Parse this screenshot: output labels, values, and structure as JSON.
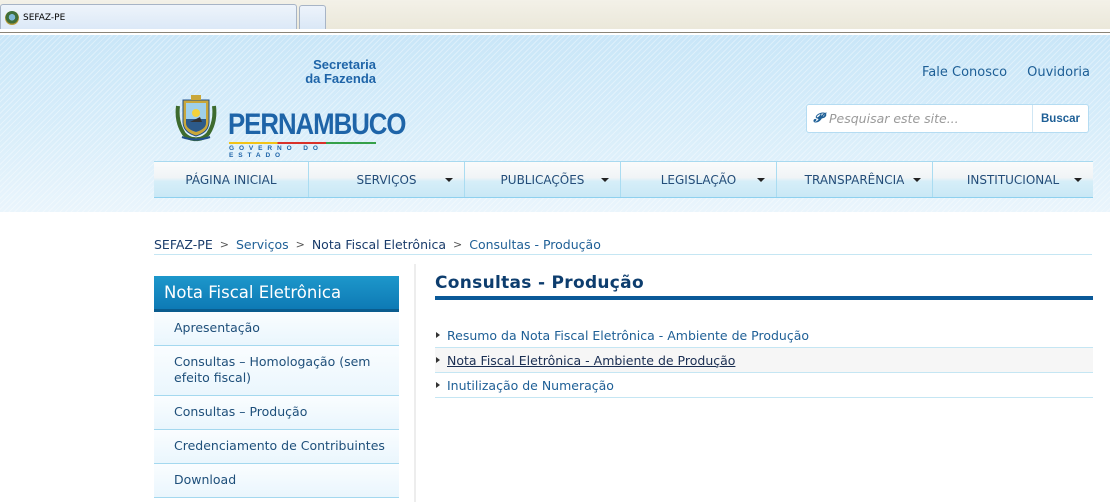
{
  "browser": {
    "tab_title": "SEFAZ-PE"
  },
  "header": {
    "logo": {
      "secretaria_line1": "Secretaria",
      "secretaria_line2": "da Fazenda",
      "state_name": "PERNAMBUCO",
      "subtitle": "GOVERNO DO ESTADO"
    },
    "top_links": [
      "Fale Conosco",
      "Ouvidoria"
    ],
    "search": {
      "placeholder": "Pesquisar este site...",
      "button_label": "Buscar",
      "icon": "search-icon"
    },
    "nav": [
      {
        "label": "PÁGINA INICIAL",
        "has_dropdown": false
      },
      {
        "label": "SERVIÇOS",
        "has_dropdown": true
      },
      {
        "label": "PUBLICAÇÕES",
        "has_dropdown": true
      },
      {
        "label": "LEGISLAÇÃO",
        "has_dropdown": true
      },
      {
        "label": "TRANSPARÊNCIA",
        "has_dropdown": true
      },
      {
        "label": "INSTITUCIONAL",
        "has_dropdown": true
      }
    ]
  },
  "breadcrumb": {
    "items": [
      "SEFAZ-PE",
      "Serviços",
      "Nota Fiscal Eletrônica",
      "Consultas - Produção"
    ],
    "separator": ">"
  },
  "sidebar": {
    "title": "Nota Fiscal Eletrônica",
    "items": [
      "Apresentação",
      "Consultas – Homologação (sem efeito fiscal)",
      "Consultas – Produção",
      "Credenciamento de Contribuintes",
      "Download"
    ]
  },
  "main": {
    "title": "Consultas - Produção",
    "links": [
      "Resumo da Nota Fiscal Eletrônica - Ambiente de Produção",
      "Nota Fiscal Eletrônica - Ambiente de Produção",
      "Inutilização de Numeração"
    ]
  }
}
